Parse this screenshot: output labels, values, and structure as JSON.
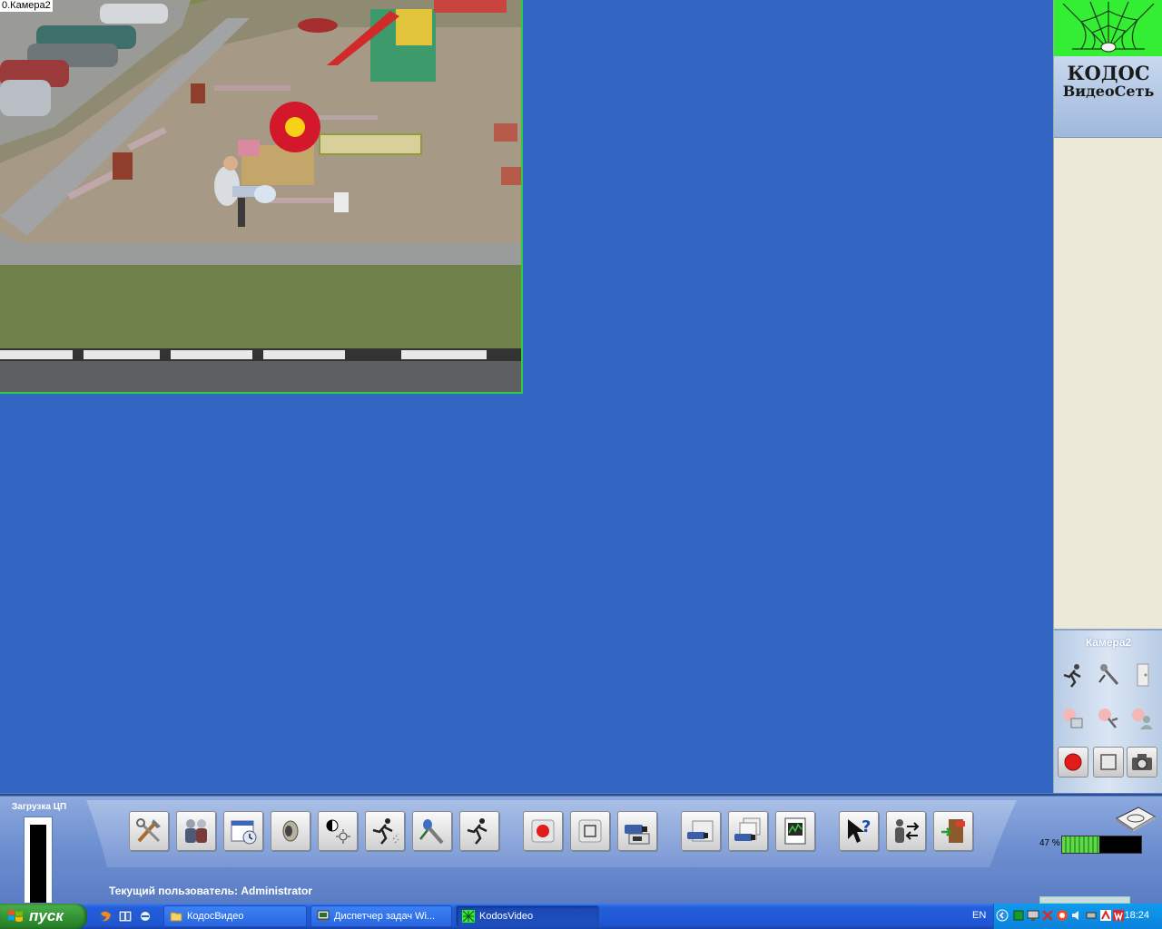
{
  "camera": {
    "label": "0.Камера2",
    "border_color": "#2ecc40"
  },
  "right_panel": {
    "logo": {
      "line1": "КОДОС",
      "line2": "ВидеоСеть"
    },
    "camera_controls": {
      "title": "Камера2",
      "icons": [
        "motion-detector-icon",
        "microphone-detector-icon",
        "door-sensor-icon",
        "alarm-zone-icon",
        "alarm-person-icon",
        "alarm-user-icon",
        "record-icon",
        "stop-icon",
        "snapshot-camera-icon"
      ]
    }
  },
  "toolbar": {
    "cpu_label": "Загрузка ЦП",
    "current_user_text": "Текущий пользователь: Administrator",
    "disk_usage_text": "47 %",
    "disk_usage_fraction": 0.47,
    "buttons": [
      "settings-tools-icon",
      "users-icon",
      "scheduler-icon",
      "sound-icon",
      "brightness-contrast-icon",
      "motion-zone-icon",
      "audio-detector-icon",
      "motion-run-icon",
      "record-icon",
      "stop-icon",
      "archive-camera-icon",
      "camera-view-icon",
      "multi-camera-icon",
      "report-icon",
      "help-pointer-icon",
      "switch-user-icon",
      "exit-icon"
    ]
  },
  "taskbar": {
    "start_label": "пуск",
    "tasks": [
      {
        "label": "КодосВидео",
        "icon": "folder-icon",
        "active": false
      },
      {
        "label": "Диспетчер задач Wi...",
        "icon": "task-manager-icon",
        "active": false
      },
      {
        "label": "KodosVideo",
        "icon": "kodos-app-icon",
        "active": true
      }
    ],
    "language": "EN",
    "clock": "18:24"
  },
  "colors": {
    "desktop": "#3366c3",
    "logo_green": "#33ee33",
    "taskbar_blue": "#245edb",
    "tray_blue": "#0f9bee"
  }
}
